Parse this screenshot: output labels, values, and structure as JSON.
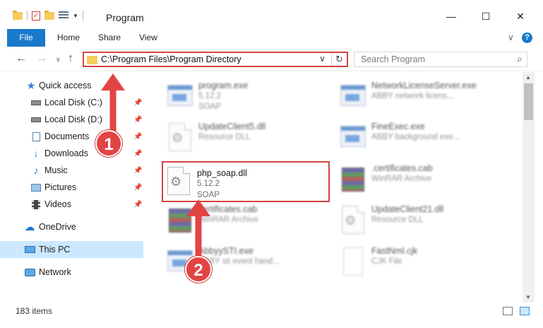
{
  "window": {
    "title": "Program",
    "minimize": "—",
    "maximize": "☐",
    "close": "✕"
  },
  "ribbon": {
    "tabs": [
      "File",
      "Home",
      "Share",
      "View"
    ],
    "expand_caret": "∨",
    "help": "?"
  },
  "address": {
    "path": "C:\\Program Files\\Program Directory",
    "search_placeholder": "Search Program"
  },
  "sidebar": {
    "items": [
      {
        "label": "Quick access",
        "icon": "star-icon",
        "pinned": false
      },
      {
        "label": "Local Disk (C:)",
        "icon": "drive-icon",
        "pinned": true
      },
      {
        "label": "Local Disk (D:)",
        "icon": "drive-icon",
        "pinned": true
      },
      {
        "label": "Documents",
        "icon": "documents-icon",
        "pinned": true
      },
      {
        "label": "Downloads",
        "icon": "downloads-icon",
        "pinned": true
      },
      {
        "label": "Music",
        "icon": "music-icon",
        "pinned": true
      },
      {
        "label": "Pictures",
        "icon": "pictures-icon",
        "pinned": true
      },
      {
        "label": "Videos",
        "icon": "videos-icon",
        "pinned": true
      },
      {
        "label": "OneDrive",
        "icon": "cloud-icon",
        "pinned": false
      },
      {
        "label": "This PC",
        "icon": "computer-icon",
        "pinned": false,
        "selected": true
      },
      {
        "label": "Network",
        "icon": "network-icon",
        "pinned": false
      }
    ]
  },
  "files": [
    {
      "name": "program.exe",
      "line2": "5.12.2",
      "line3": "SOAP",
      "icon": "exe-icon"
    },
    {
      "name": "NetworkLicenseServer.exe",
      "line2": "ABBY network licens...",
      "line3": "",
      "icon": "exe-icon"
    },
    {
      "name": "UpdateClient5.dll",
      "line2": "Resource DLL",
      "line3": "",
      "icon": "dll-icon"
    },
    {
      "name": "FineExec.exe",
      "line2": "ABBY background exe...",
      "line3": "",
      "icon": "exe-icon"
    },
    {
      "name": "php_soap.dll",
      "line2": "5.12.2",
      "line3": "SOAP",
      "icon": "dll-icon",
      "highlighted": true
    },
    {
      "name": ".certificates.cab",
      "line2": "WinRAR Archive",
      "line3": "",
      "icon": "archive-icon"
    },
    {
      "name": "certificates.cab",
      "line2": "WinRAR Archive",
      "line3": "",
      "icon": "archive-icon"
    },
    {
      "name": "UpdateClient21.dll",
      "line2": "Resource DLL",
      "line3": "",
      "icon": "dll-icon"
    },
    {
      "name": "AbbyySTI.exe",
      "line2": "ABBY sti event hand...",
      "line3": "",
      "icon": "exe-icon"
    },
    {
      "name": "FastNml.cjk",
      "line2": "CJK File",
      "line3": "",
      "icon": "file-icon"
    }
  ],
  "status": {
    "item_count": "183 items"
  },
  "annotations": {
    "step1": "1",
    "step2": "2",
    "color": "#e24444"
  }
}
